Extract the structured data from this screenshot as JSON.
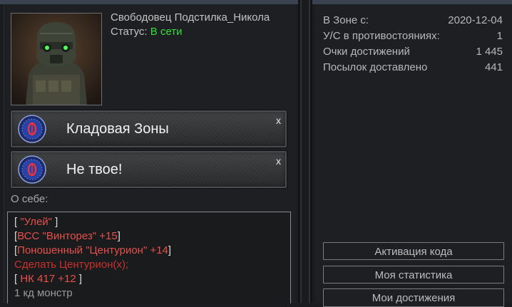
{
  "profile": {
    "username": "Свободовец Подстилка_Никола",
    "status_label": "Статус:",
    "status_value": "В сети"
  },
  "badges": [
    {
      "title": "Кладовая Зоны",
      "close": "x",
      "icon": "stalker-emblem-icon"
    },
    {
      "title": "Не твое!",
      "close": "x",
      "icon": "stalker-emblem-icon"
    }
  ],
  "about": {
    "label": "О себе:",
    "lines": [
      {
        "open": "[ ",
        "text": "\"Улей\"",
        "close": " ]"
      },
      {
        "open": "[",
        "text": "ВСС \"Винторез\" +15",
        "close": "]"
      },
      {
        "open": "[",
        "text": "Поношенный \"Центурион\" +14",
        "close": "]"
      },
      {
        "text": "Сделать Центурион(x);"
      },
      {
        "open": "[ ",
        "text": "НК 417 +12",
        "close": " ]"
      },
      {
        "text": "1 кд монстр"
      }
    ]
  },
  "stats": [
    {
      "label": "В Зоне с:",
      "value": "2020-12-04"
    },
    {
      "label": "У/С в противостояниях:",
      "value": "1"
    },
    {
      "label": "Очки достижений",
      "value": "1 445"
    },
    {
      "label": "Посылок доставлено",
      "value": "441"
    }
  ],
  "buttons": {
    "activate_code": "Активация кода",
    "my_stats": "Моя статистика",
    "my_achievements": "Мои достижения"
  },
  "colors": {
    "online": "#33e03a",
    "red_text": "#e6504a",
    "background": "#1b1c1f"
  }
}
